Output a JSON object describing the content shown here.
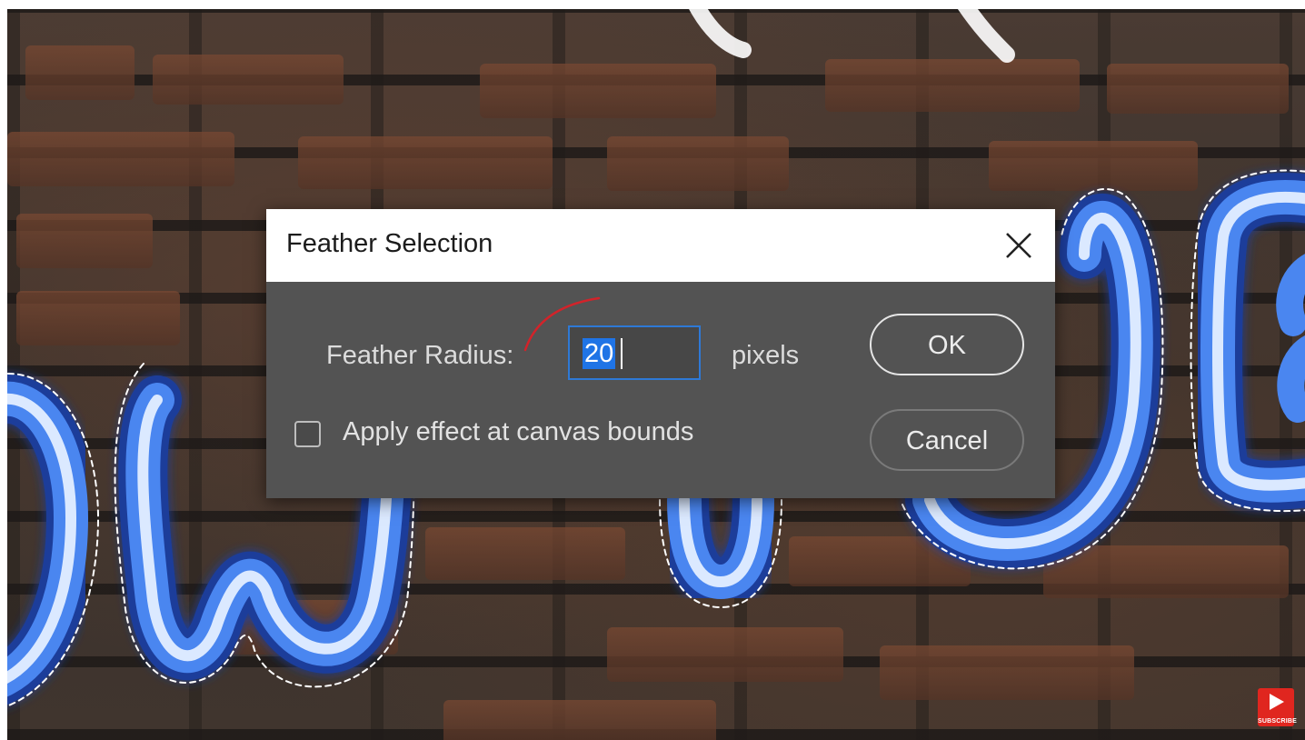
{
  "dialog": {
    "title": "Feather Selection",
    "close_icon": "close-icon",
    "radius_label": "Feather Radius:",
    "radius_value": "20",
    "units_label": "pixels",
    "checkbox_label": "Apply effect at canvas bounds",
    "checkbox_checked": false,
    "ok_label": "OK",
    "cancel_label": "Cancel"
  },
  "overlay": {
    "subscribe_label": "SUBSCRIBE",
    "subscribe_icon": "play-icon"
  },
  "colors": {
    "dialog_bg": "#535353",
    "title_bar_bg": "#ffffff",
    "input_focus": "#2e79d6",
    "selection_highlight": "#1f74e6",
    "neon_blue": "#4a86f0",
    "subscribe_red": "#e0261f"
  }
}
